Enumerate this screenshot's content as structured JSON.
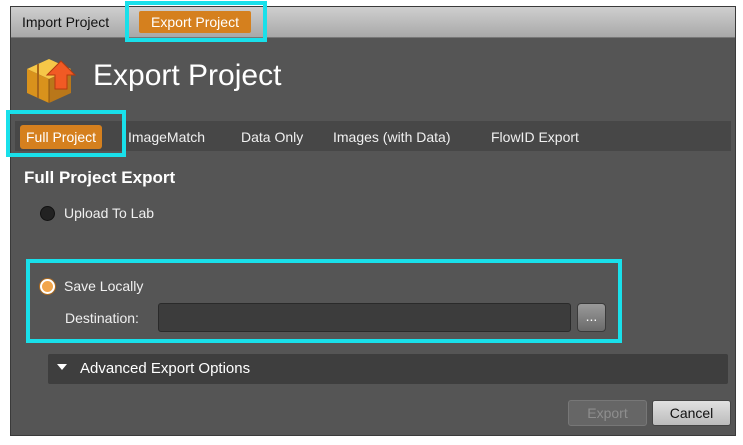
{
  "window": {
    "top_tabs": [
      {
        "label": "Import Project",
        "active": false
      },
      {
        "label": "Export Project",
        "active": true
      }
    ],
    "header": {
      "title": "Export Project",
      "icon": "package-export-icon"
    },
    "sub_tabs": [
      {
        "label": "Full Project",
        "active": true
      },
      {
        "label": "ImageMatch",
        "active": false
      },
      {
        "label": "Data Only",
        "active": false
      },
      {
        "label": "Images (with Data)",
        "active": false
      },
      {
        "label": "FlowID Export",
        "active": false
      }
    ],
    "section_title": "Full Project Export",
    "options": [
      {
        "label": "Upload To Lab",
        "selected": false
      },
      {
        "label": "Save Locally",
        "selected": true
      }
    ],
    "destination": {
      "label": "Destination:",
      "value": "",
      "browse_label": "..."
    },
    "advanced": {
      "label": "Advanced Export Options",
      "expanded": false
    },
    "buttons": {
      "export": "Export",
      "cancel": "Cancel"
    }
  },
  "colors": {
    "accent": "#d5801e",
    "highlight": "#19e0ea",
    "panel": "#555555"
  }
}
